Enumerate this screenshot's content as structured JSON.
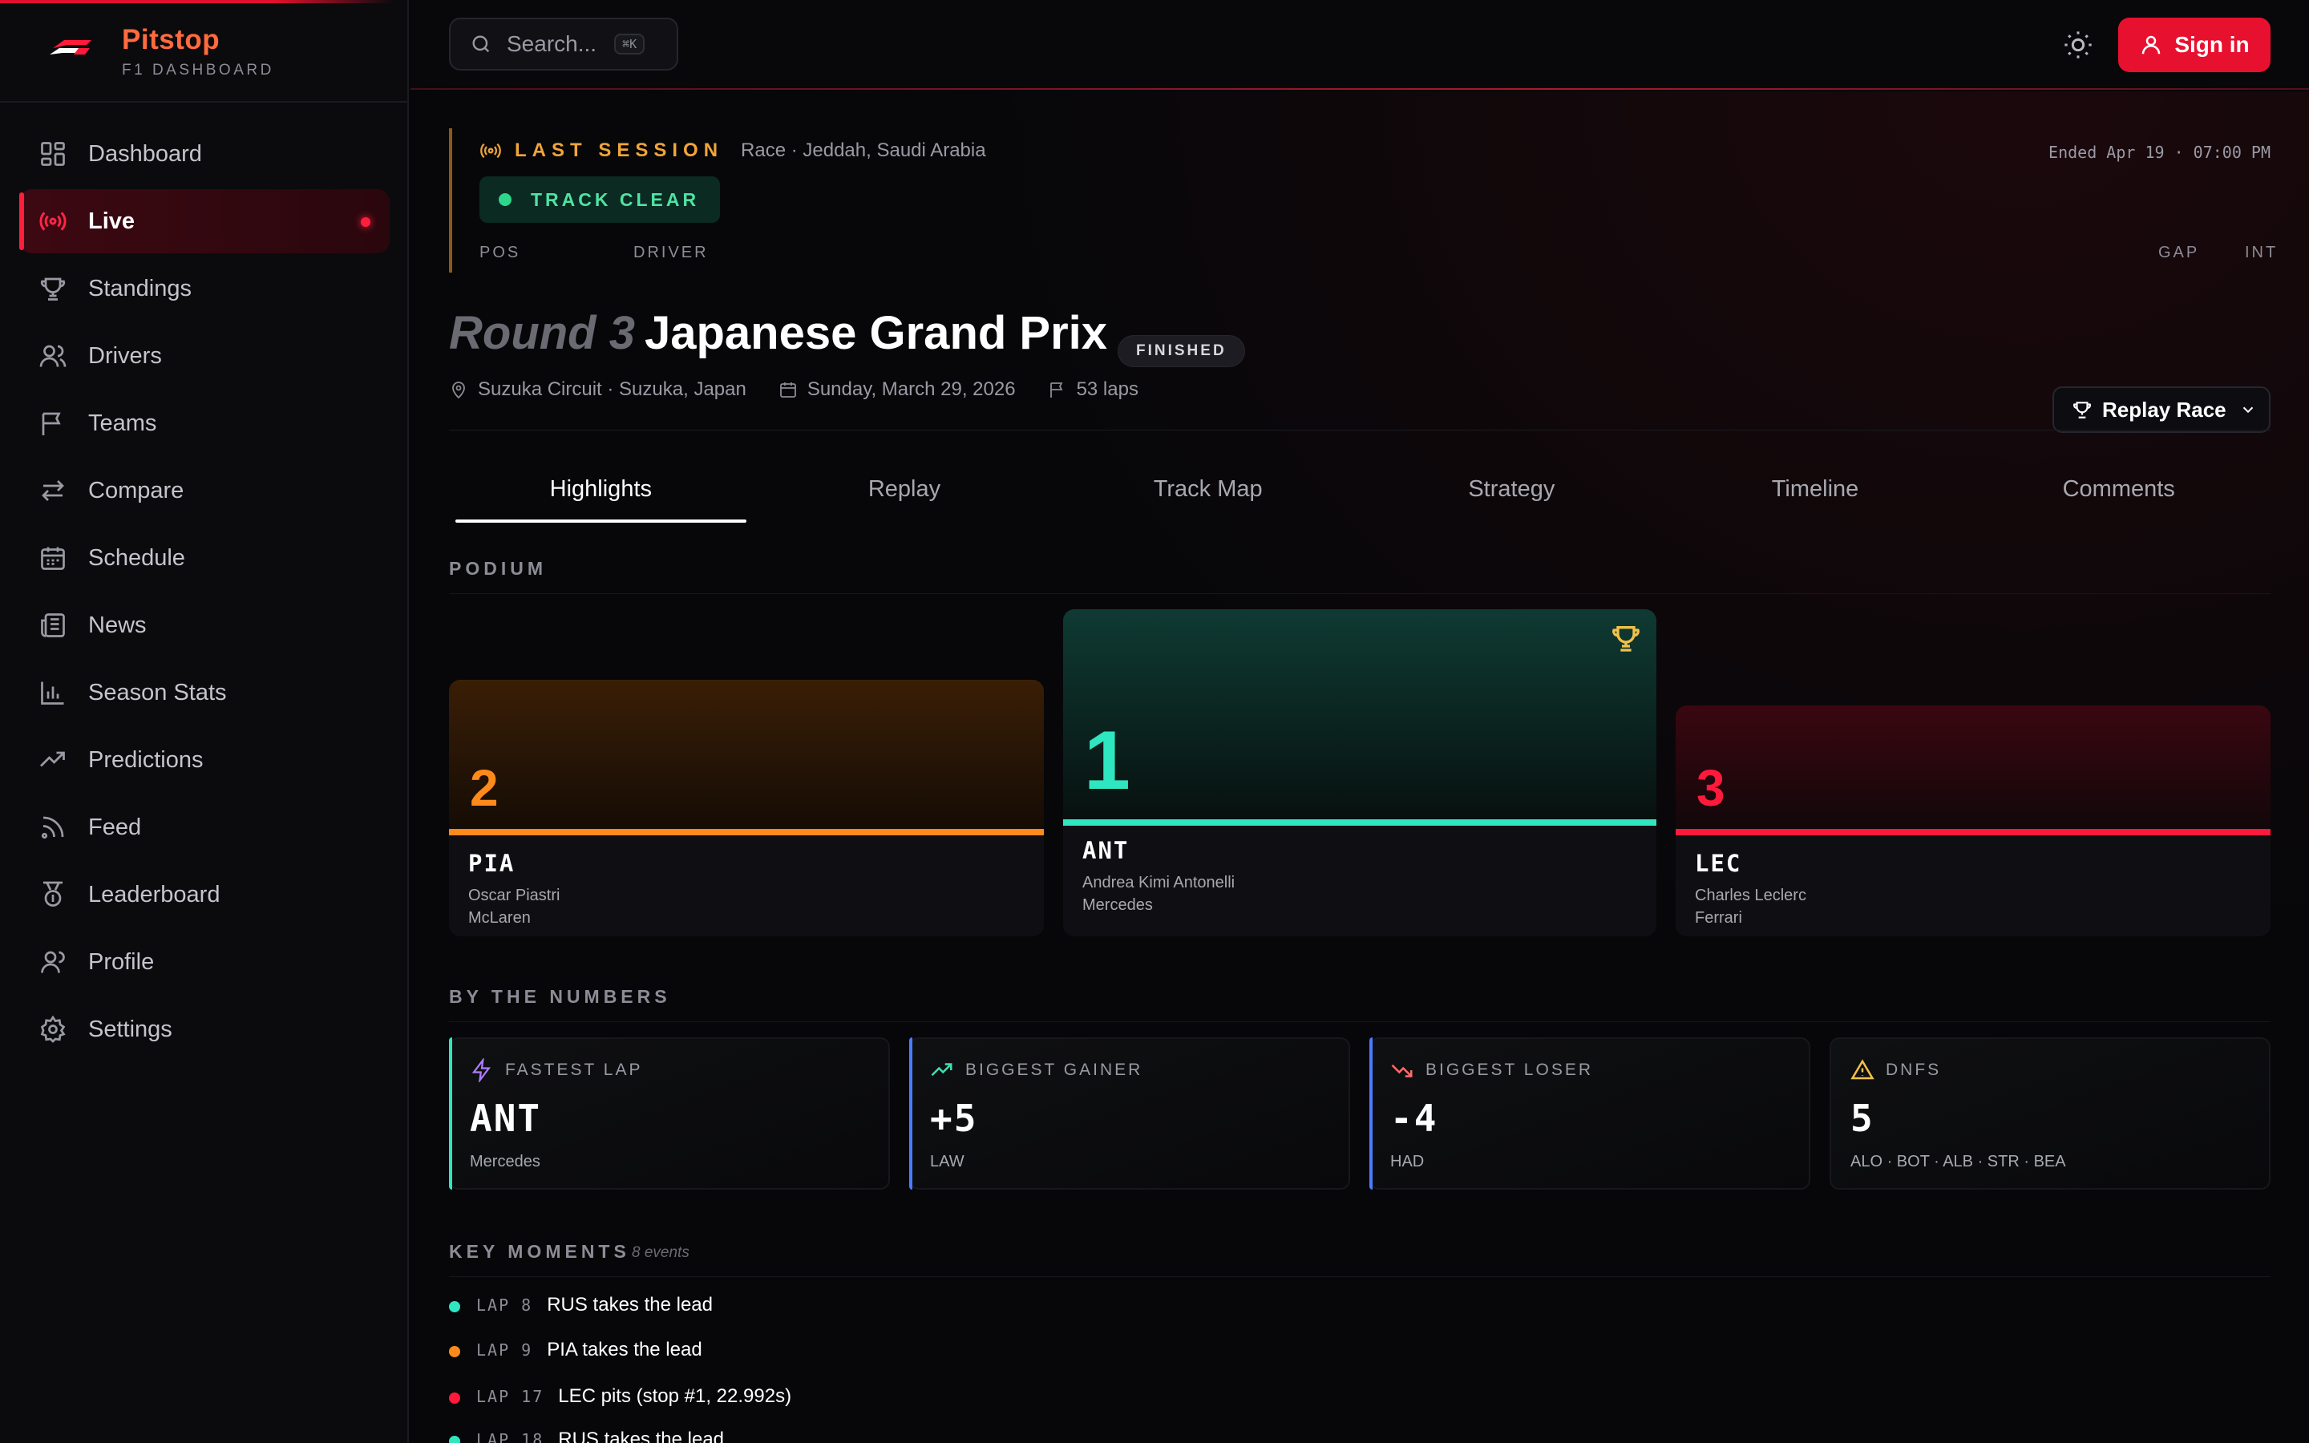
{
  "brand": {
    "name": "Pitstop",
    "subtitle": "F1 DASHBOARD"
  },
  "nav": [
    {
      "label": "Dashboard",
      "icon": "dashboard-icon"
    },
    {
      "label": "Live",
      "icon": "live-broadcast-icon",
      "active": true
    },
    {
      "label": "Standings",
      "icon": "trophy-icon"
    },
    {
      "label": "Drivers",
      "icon": "users-icon"
    },
    {
      "label": "Teams",
      "icon": "flag-icon"
    },
    {
      "label": "Compare",
      "icon": "compare-arrows-icon"
    },
    {
      "label": "Schedule",
      "icon": "calendar-icon"
    },
    {
      "label": "News",
      "icon": "newspaper-icon"
    },
    {
      "label": "Season Stats",
      "icon": "bar-chart-icon"
    },
    {
      "label": "Predictions",
      "icon": "trending-up-icon"
    },
    {
      "label": "Feed",
      "icon": "rss-icon"
    },
    {
      "label": "Leaderboard",
      "icon": "medal-icon"
    },
    {
      "label": "Profile",
      "icon": "user-icon"
    },
    {
      "label": "Settings",
      "icon": "gear-icon"
    }
  ],
  "header": {
    "search_placeholder": "Search...",
    "search_shortcut": "⌘K",
    "signin_label": "Sign in"
  },
  "last_session": {
    "label": "LAST SESSION",
    "detail": "Race · Jeddah, Saudi Arabia",
    "ended": "Ended Apr 19 · 07:00 PM",
    "status": "TRACK CLEAR",
    "columns": {
      "pos": "POS",
      "driver": "DRIVER",
      "gap": "GAP",
      "int": "INT"
    }
  },
  "race": {
    "round": "Round 3",
    "name": "Japanese Grand Prix",
    "status": "FINISHED",
    "circuit": "Suzuka Circuit · Suzuka, Japan",
    "date": "Sunday, March 29, 2026",
    "laps": "53 laps",
    "replay_label": "Replay Race"
  },
  "tabs": [
    "Highlights",
    "Replay",
    "Track Map",
    "Strategy",
    "Timeline",
    "Comments"
  ],
  "podium": {
    "title": "PODIUM",
    "p1": {
      "pos": "1",
      "code": "ANT",
      "name": "Andrea Kimi Antonelli",
      "team": "Mercedes",
      "color": "#2ee6c0"
    },
    "p2": {
      "pos": "2",
      "code": "PIA",
      "name": "Oscar Piastri",
      "team": "McLaren",
      "color": "#ff8a1c"
    },
    "p3": {
      "pos": "3",
      "code": "LEC",
      "name": "Charles Leclerc",
      "team": "Ferrari",
      "color": "#ff1a3c"
    }
  },
  "numbers": {
    "title": "BY THE NUMBERS",
    "fastest_lap": {
      "label": "FASTEST LAP",
      "value": "ANT",
      "sub": "Mercedes"
    },
    "biggest_gainer": {
      "label": "BIGGEST GAINER",
      "value": "+5",
      "sub": "LAW"
    },
    "biggest_loser": {
      "label": "BIGGEST LOSER",
      "value": "-4",
      "sub": "HAD"
    },
    "dnfs": {
      "label": "DNFS",
      "value": "5",
      "sub": "ALO · BOT · ALB · STR · BEA"
    }
  },
  "key_moments": {
    "title": "KEY MOMENTS",
    "count": "8 events",
    "items": [
      {
        "lap": "LAP 8",
        "text": "RUS takes the lead",
        "color": "#2ee6c0"
      },
      {
        "lap": "LAP 9",
        "text": "PIA takes the lead",
        "color": "#ff8a1c"
      },
      {
        "lap": "LAP 17",
        "text": "LEC pits (stop #1, 22.992s)",
        "color": "#ff1a3c"
      },
      {
        "lap": "LAP 18",
        "text": "RUS takes the lead",
        "color": "#2ee6c0"
      }
    ]
  }
}
